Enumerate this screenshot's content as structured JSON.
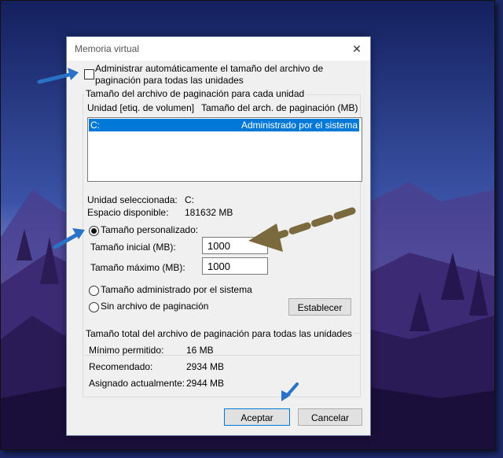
{
  "dialog": {
    "title": "Memoria virtual",
    "close_glyph": "✕",
    "auto_manage_label_line1": "Administrar automáticamente el tamaño del archivo de",
    "auto_manage_label_line2": "paginación para todas las unidades",
    "auto_manage_checked": false
  },
  "per_drive": {
    "group_label": "Tamaño del archivo de paginación para cada unidad",
    "col_drive": "Unidad [etiq. de volumen]",
    "col_size": "Tamaño del arch. de paginación (MB)",
    "rows": [
      {
        "drive": "C:",
        "size": "Administrado por el sistema",
        "selected": true
      }
    ],
    "selected_drive_label": "Unidad seleccionada:",
    "selected_drive_value": "C:",
    "free_space_label": "Espacio disponible:",
    "free_space_value": "181632 MB",
    "custom_size_label": "Tamaño personalizado:",
    "initial_size_label": "Tamaño inicial (MB):",
    "initial_size_value": "1000",
    "max_size_label": "Tamaño máximo (MB):",
    "max_size_value": "1000",
    "system_managed_label": "Tamaño administrado por el sistema",
    "no_paging_label": "Sin archivo de paginación",
    "set_button": "Establecer",
    "selected_option": "custom"
  },
  "totals": {
    "group_label": "Tamaño total del archivo de paginación para todas las unidades",
    "min_label": "Mínimo permitido:",
    "min_value": "16 MB",
    "recommended_label": "Recomendado:",
    "recommended_value": "2934 MB",
    "allocated_label": "Asignado actualmente:",
    "allocated_value": "2944 MB"
  },
  "buttons": {
    "ok": "Aceptar",
    "cancel": "Cancelar"
  },
  "colors": {
    "accent": "#0078d7",
    "arrow_blue": "#2a72c8",
    "arrow_olive": "#7a6a3e"
  }
}
